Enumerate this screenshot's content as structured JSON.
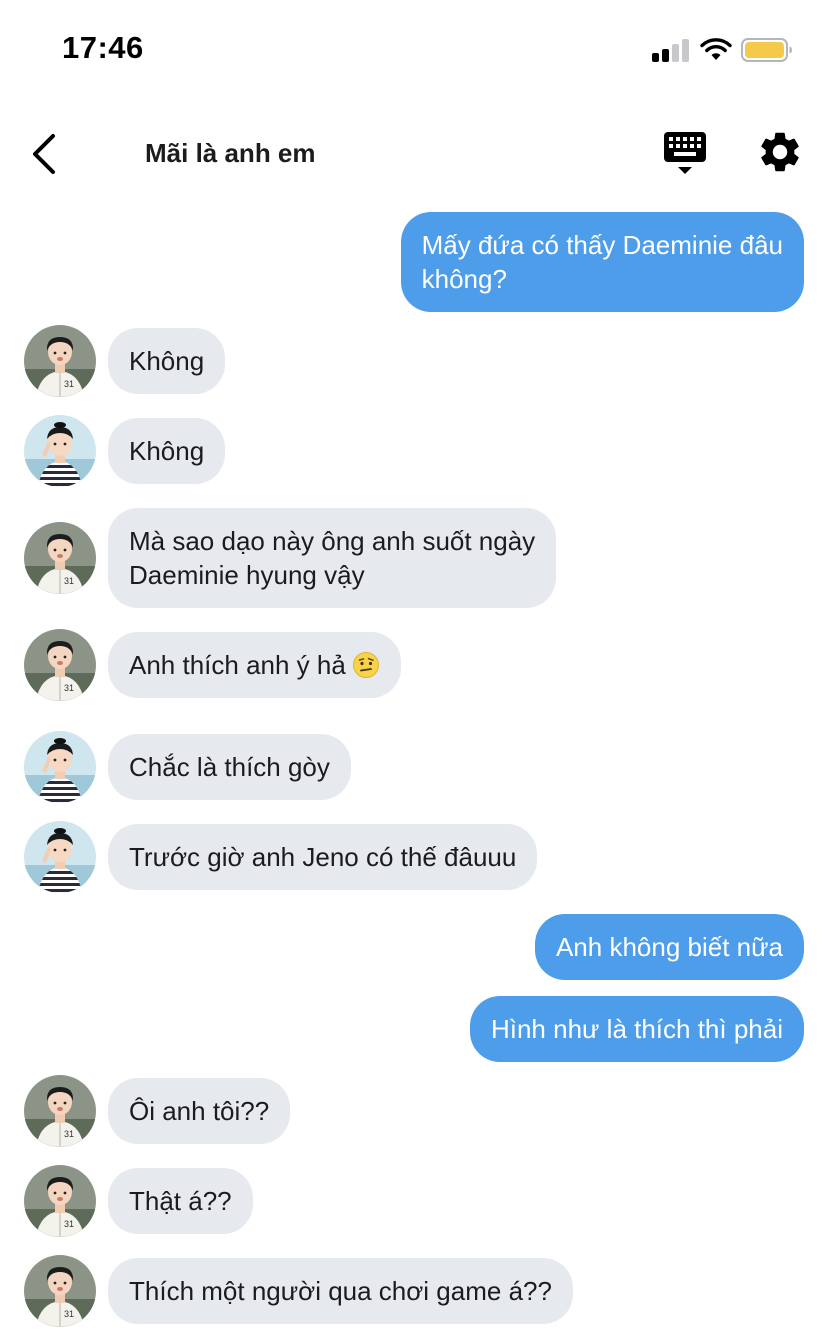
{
  "status_bar": {
    "time": "17:46",
    "battery_color": "#f5c94a"
  },
  "header": {
    "title": "Mãi là anh em",
    "back_icon": "chevron-left-icon",
    "keyboard_icon": "keyboard-icon",
    "settings_icon": "gear-icon"
  },
  "colors": {
    "outgoing_bubble": "#4d9deb",
    "incoming_bubble": "#e6e9ee"
  },
  "messages": [
    {
      "side": "out",
      "text": "Mấy đứa có thấy Daeminie đâu\nkhông?"
    },
    {
      "side": "in",
      "avatar": "avatar-white-jacket",
      "text": "Không"
    },
    {
      "side": "in",
      "avatar": "avatar-striped-shirt",
      "text": "Không"
    },
    {
      "side": "in",
      "avatar": "avatar-white-jacket",
      "text": "Mà sao dạo này ông anh suốt ngày\nDaeminie hyung vậy"
    },
    {
      "side": "in",
      "avatar": "avatar-white-jacket",
      "text": "Anh thích anh ý hả",
      "emoji": "🤨"
    },
    {
      "side": "in",
      "avatar": "avatar-striped-shirt",
      "text": "Chắc là thích gòy"
    },
    {
      "side": "in",
      "avatar": "avatar-striped-shirt",
      "text": "Trước giờ anh Jeno có thế đâuuu"
    },
    {
      "side": "out",
      "text": "Anh không biết nữa"
    },
    {
      "side": "out",
      "text": "Hình như là thích thì phải"
    },
    {
      "side": "in",
      "avatar": "avatar-white-jacket",
      "text": "Ôi anh tôi??"
    },
    {
      "side": "in",
      "avatar": "avatar-white-jacket",
      "text": "Thật á??"
    },
    {
      "side": "in",
      "avatar": "avatar-white-jacket",
      "text": "Thích một người qua chơi game á??"
    }
  ]
}
